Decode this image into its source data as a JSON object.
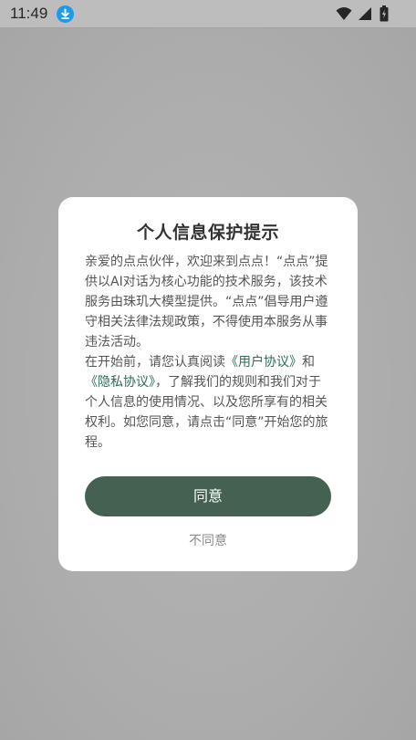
{
  "status_bar": {
    "time": "11:49",
    "icons": [
      "download-icon",
      "wifi-icon",
      "signal-icon",
      "battery-icon"
    ]
  },
  "dialog": {
    "title": "个人信息保护提示",
    "paragraph1": "亲爱的点点伙伴，欢迎来到点点！“点点”提供以AI对话为核心功能的技术服务，该技术服务由珠玑大模型提供。“点点”倡导用户遵守相关法律法规政策，不得使用本服务从事违法活动。",
    "paragraph2_before": "在开始前，请您认真阅读",
    "user_agreement_link": "《用户协议》",
    "paragraph2_and": "和",
    "privacy_agreement_link": "《隐私协议》",
    "paragraph2_after": "，了解我们的规则和我们对于个人信息的使用情况、以及您所享有的相关权利。如您同意，请点击“同意”开始您的旅程。",
    "agree_label": "同意",
    "disagree_label": "不同意"
  },
  "colors": {
    "accent_button": "#446152",
    "link": "#2d6b5a",
    "download_badge": "#1e9be8"
  }
}
